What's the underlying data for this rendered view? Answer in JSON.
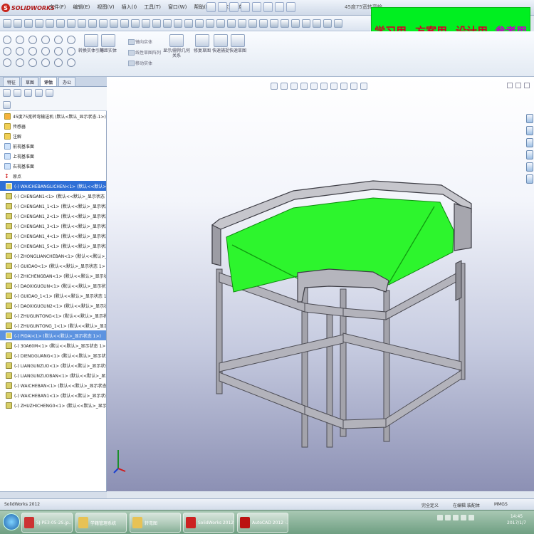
{
  "app": {
    "logo_text": "SOLIDWORKS",
    "menus": [
      "文件(F)",
      "编辑(E)",
      "视图(V)",
      "插入(I)",
      "工具(T)",
      "窗口(W)",
      "帮助(H)",
      "自定义菜单"
    ],
    "doc_title": "45度75宽转弯输..."
  },
  "banner": {
    "items": [
      "学习用",
      "方案用",
      "设计用"
    ],
    "last": "参考用",
    "bg_color": "#00ef20",
    "text_color": "#d0002a",
    "last_color": "#c200c8"
  },
  "ribbon": {
    "groups": [
      "转换实体引用",
      "等距实体",
      "镜向实体",
      "线性草图阵列",
      "移动实体",
      "显示/删除几何关系",
      "修复草图",
      "快速捕捉",
      "快速草图"
    ],
    "small": [
      "镜向实体",
      "线性草图阵列",
      "移动实体"
    ]
  },
  "tabs": [
    "特征",
    "草图",
    "评估",
    "办公"
  ],
  "tree": {
    "root": "45度75宽转弯输送机 (默认<默认_显示状态-1>)",
    "items": [
      {
        "label": "传感器",
        "kind": "folder"
      },
      {
        "label": "注解",
        "kind": "folder"
      },
      {
        "label": "前视基准面",
        "kind": "plane"
      },
      {
        "label": "上视基准面",
        "kind": "plane"
      },
      {
        "label": "右视基准面",
        "kind": "plane"
      },
      {
        "label": "原点",
        "kind": "origin"
      },
      {
        "label": "(-) WAICHEBANGLICHEN<1> (默认<<默认>_显示",
        "kind": "part",
        "state": "sel"
      },
      {
        "label": "(-) CHENGAN1<1> (默认<<默认>_显示状态 1>",
        "kind": "part"
      },
      {
        "label": "(-) CHENGAN1_1<1> (默认<<默认>_显示状态 1",
        "kind": "part"
      },
      {
        "label": "(-) CHENGAN1_2<1> (默认<<默认>_显示状态",
        "kind": "part"
      },
      {
        "label": "(-) CHENGAN1_3<1> (默认<<默认>_显示状态",
        "kind": "part"
      },
      {
        "label": "(-) CHENGAN1_4<1> (默认<<默认>_显示状态",
        "kind": "part"
      },
      {
        "label": "(-) CHENGAN1_5<1> (默认<<默认>_显示状态",
        "kind": "part"
      },
      {
        "label": "(-) ZHONGLIANCHEBAN<1> (默认<<默认>_显",
        "kind": "part"
      },
      {
        "label": "(-) GUIDAO<1> (默认<<默认>_显示状态 1>",
        "kind": "part"
      },
      {
        "label": "(-) ZHICHENGBAN<1> (默认<<默认>_显示状态",
        "kind": "part"
      },
      {
        "label": "(-) DAOXIGUGUN<1> (默认<<默认>_显示状态 1>",
        "kind": "part"
      },
      {
        "label": "(-) GUIDAO_1<1> (默认<<默认>_显示状态 1>",
        "kind": "part"
      },
      {
        "label": "(-) DAOXIGUGUN2<1> (默认<<默认>_显示状态",
        "kind": "part"
      },
      {
        "label": "(-) ZHUGUNTONG<1> (默认<<默认>_显示状态",
        "kind": "part"
      },
      {
        "label": "(-) ZHUGUNTONG_1<1> (默认<<默认>_显示状态",
        "kind": "part"
      },
      {
        "label": "(-) PIDAI<1> (默认<<默认>_显示状态 1>)",
        "kind": "part",
        "state": "sel2"
      },
      {
        "label": "(-) 30A60M<1> (默认<<默认>_显示状态 1>",
        "kind": "part"
      },
      {
        "label": "(-) DIENGGUANG<1> (默认<<默认>_显示状态",
        "kind": "part"
      },
      {
        "label": "(-) LIANGUNZUO<1> (默认<<默认>_显示状态",
        "kind": "part"
      },
      {
        "label": "(-) LIANGUNZUOBAN<1> (默认<<默认>_显示状",
        "kind": "part"
      },
      {
        "label": "(-) WAICHEBAN<1> (默认<<默认>_显示状态",
        "kind": "part"
      },
      {
        "label": "(-) WAICHEBAN1<1> (默认<<默认>_显示状态",
        "kind": "part"
      },
      {
        "label": "(-) ZHUZHICHENG0<1> (默认<<默认>_显示状",
        "kind": "part"
      }
    ]
  },
  "status": {
    "left": "SolidWorks 2012",
    "right": [
      "完全定义",
      "在编辑 装配体",
      "MMGS"
    ]
  },
  "taskbar": [
    {
      "label": "SJ-PE3-05-2S.jp...",
      "color": "#c33"
    },
    {
      "label": "学籍管理系统",
      "color": "#e7c255"
    },
    {
      "label": "转弯图",
      "color": "#e7c255"
    },
    {
      "label": "SolidWorks 2012...",
      "color": "#c22"
    },
    {
      "label": "AutoCAD 2012 -...",
      "color": "#b11"
    }
  ],
  "clock": {
    "time": "14:45",
    "date": "2017/1/7"
  },
  "model": {
    "belt_color": "#2df52d",
    "frame_color": "#9e9ea6"
  }
}
